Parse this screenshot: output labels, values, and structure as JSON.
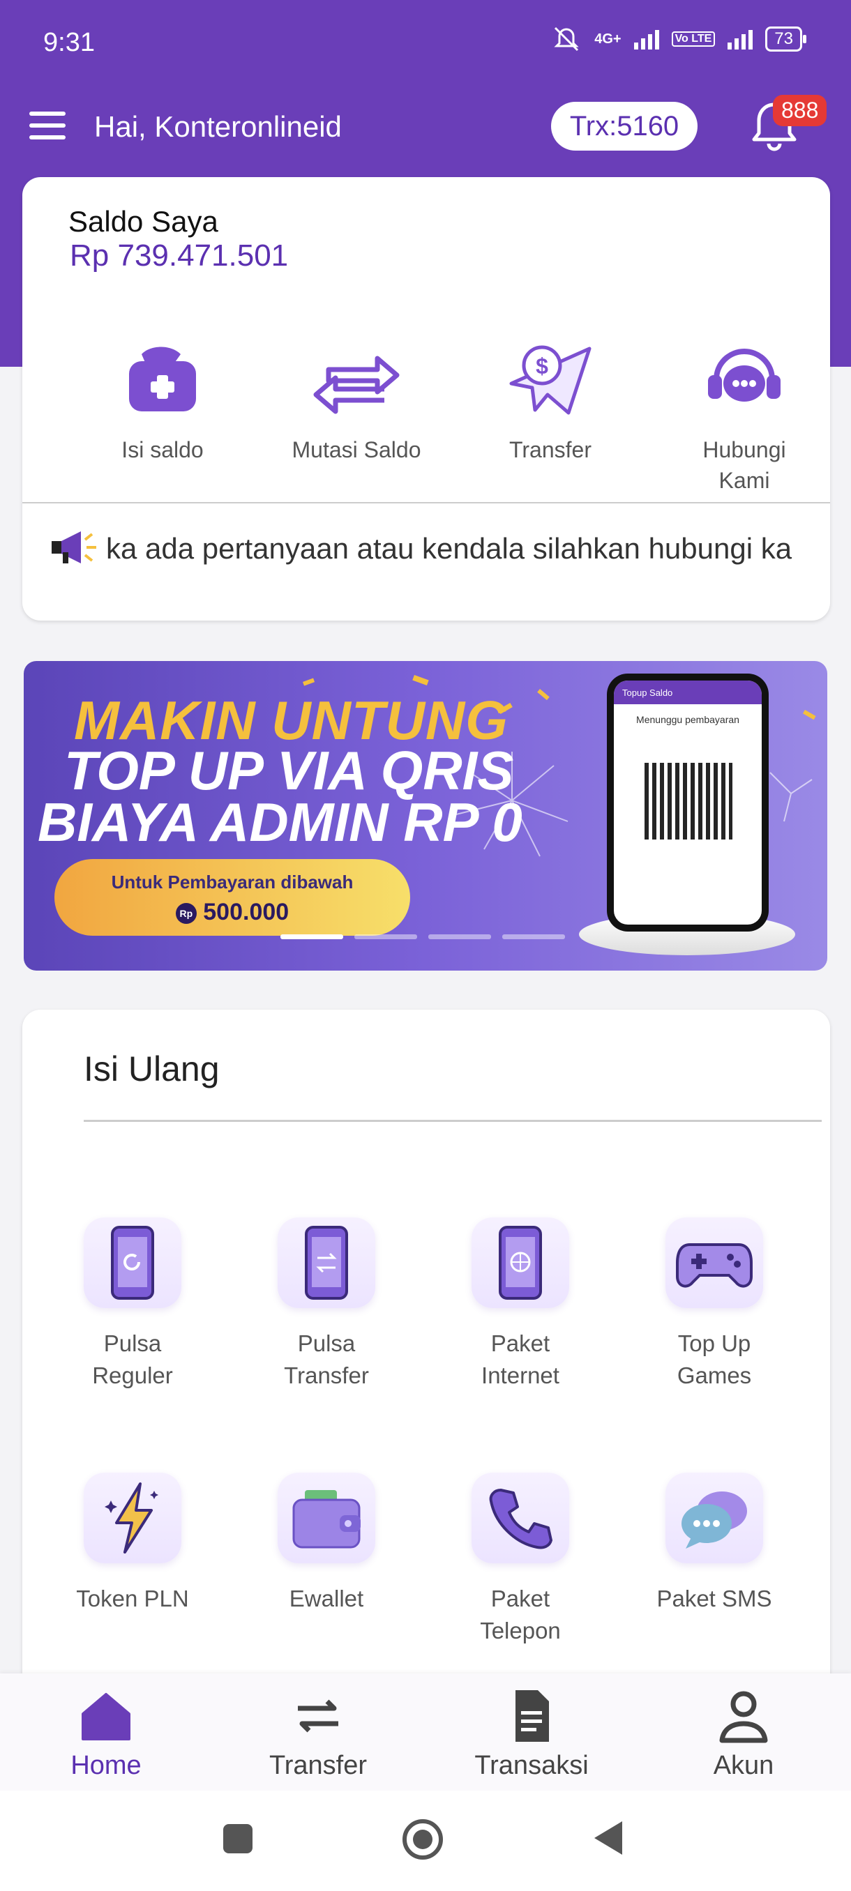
{
  "status_bar": {
    "time": "9:31",
    "network_1": "4G+",
    "network_2": "Vo LTE",
    "battery": "73"
  },
  "header": {
    "greeting": "Hai, Konteronlineid",
    "trx": "Trx:5160",
    "notification_count": "888"
  },
  "saldo": {
    "title": "Saldo Saya",
    "value": "Rp 739.471.501",
    "actions": [
      {
        "label": "Isi saldo",
        "icon": "wallet-plus-icon"
      },
      {
        "label": "Mutasi Saldo",
        "icon": "swap-arrows-icon"
      },
      {
        "label": "Transfer",
        "icon": "money-paperplane-icon"
      },
      {
        "label": "Hubungi Kami",
        "icon": "support-chat-icon"
      }
    ],
    "announcement": "ka ada pertanyaan atau kendala silahkan hubungi ka"
  },
  "banner": {
    "line1": "MAKIN UNTUNG",
    "line2": "TOP UP VIA QRIS",
    "line3": "BIAYA ADMIN RP 0",
    "pill_1": "Untuk Pembayaran dibawah",
    "pill_2": "500.000",
    "phone_header": "Topup Saldo",
    "phone_title": "Menunggu pembayaran",
    "active_slide": 0,
    "slide_count": 4
  },
  "isi_ulang": {
    "title": "Isi Ulang",
    "items": [
      {
        "label": "Pulsa Reguler",
        "icon": "phone-refresh-icon"
      },
      {
        "label": "Pulsa Transfer",
        "icon": "phone-transfer-icon"
      },
      {
        "label": "Paket Internet",
        "icon": "phone-globe-icon"
      },
      {
        "label": "Top Up Games",
        "icon": "gamepad-icon"
      },
      {
        "label": "Token PLN",
        "icon": "lightning-icon"
      },
      {
        "label": "Ewallet",
        "icon": "wallet-icon"
      },
      {
        "label": "Paket Telepon",
        "icon": "telephone-icon"
      },
      {
        "label": "Paket SMS",
        "icon": "chat-bubbles-icon"
      }
    ]
  },
  "bottom_nav": {
    "items": [
      {
        "label": "Home",
        "icon": "home-icon",
        "active": true
      },
      {
        "label": "Transfer",
        "icon": "transfer-arrows-icon",
        "active": false
      },
      {
        "label": "Transaksi",
        "icon": "document-icon",
        "active": false
      },
      {
        "label": "Akun",
        "icon": "user-icon",
        "active": false
      }
    ]
  },
  "colors": {
    "primary": "#6a3eb8",
    "accent_text": "#5b30b0",
    "badge": "#e53935",
    "banner_gold": "#f5c03d"
  }
}
